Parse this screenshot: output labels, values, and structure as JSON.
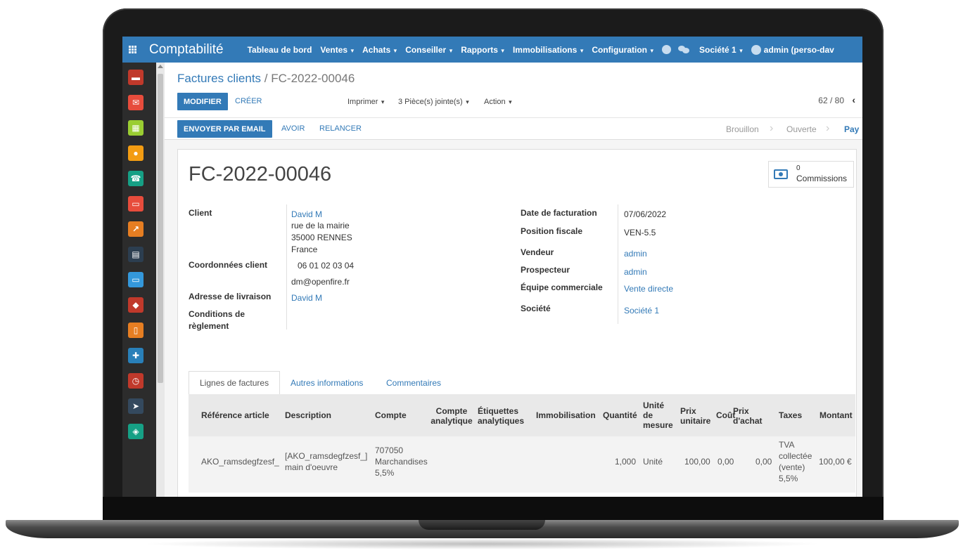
{
  "topnav": {
    "brand": "Comptabilité",
    "menus": [
      "Tableau de bord",
      "Ventes",
      "Achats",
      "Conseiller",
      "Rapports",
      "Immobilisations",
      "Configuration"
    ],
    "company": "Société 1",
    "user": "admin (perso-dav"
  },
  "sidebar": {
    "icons": [
      {
        "name": "discuss-icon",
        "color": "#c0392b"
      },
      {
        "name": "mail-icon",
        "color": "#e74c3c"
      },
      {
        "name": "calendar-icon",
        "color": "#9acd32"
      },
      {
        "name": "map-pin-icon",
        "color": "#f39c12"
      },
      {
        "name": "contacts-icon",
        "color": "#16a085"
      },
      {
        "name": "folder-icon",
        "color": "#e74c3c"
      },
      {
        "name": "chart-icon",
        "color": "#e67e22"
      },
      {
        "name": "calculator-icon",
        "color": "#2c3e50"
      },
      {
        "name": "card-icon",
        "color": "#3498db"
      },
      {
        "name": "box-icon",
        "color": "#c0392b"
      },
      {
        "name": "document-icon",
        "color": "#e67e22"
      },
      {
        "name": "puzzle-icon",
        "color": "#2980b9"
      },
      {
        "name": "clock-icon",
        "color": "#c0392b"
      },
      {
        "name": "send-icon",
        "color": "#34495e"
      },
      {
        "name": "ticket-icon",
        "color": "#16a085"
      }
    ]
  },
  "breadcrumb": {
    "parent": "Factures clients",
    "separator": "/",
    "current": "FC-2022-00046"
  },
  "actions": {
    "edit": "MODIFIER",
    "create": "CRÉER",
    "print": "Imprimer",
    "attachments": "3 Pièce(s) jointe(s)",
    "action": "Action",
    "pager": "62 / 80",
    "prev": "‹",
    "next": "›"
  },
  "statusbar": {
    "send_email": "ENVOYER PAR EMAIL",
    "credit_note": "AVOIR",
    "follow_up": "RELANCER",
    "stages": [
      "Brouillon",
      "Ouverte",
      "Pay"
    ]
  },
  "invoice": {
    "title": "FC-2022-00046",
    "commissions_count": "0",
    "commissions_label": "Commissions",
    "labels": {
      "client": "Client",
      "contact": "Coordonnées client",
      "delivery": "Adresse de livraison",
      "terms": "Conditions de règlement",
      "invoice_date": "Date de facturation",
      "fiscal_position": "Position fiscale",
      "salesperson": "Vendeur",
      "prospector": "Prospecteur",
      "team": "Équipe commerciale",
      "company": "Société"
    },
    "client_name": "David M",
    "address": [
      "rue de la mairie",
      "35000 RENNES",
      "France"
    ],
    "phone": "06 01 02 03 04",
    "email": "dm@openfire.fr",
    "delivery_address": "David M",
    "invoice_date": "07/06/2022",
    "fiscal_position": "VEN-5.5",
    "salesperson": "admin",
    "prospector": "admin",
    "team": "Vente directe",
    "company": "Société 1"
  },
  "tabs": [
    "Lignes de factures",
    "Autres informations",
    "Commentaires"
  ],
  "lines": {
    "headers": {
      "ref": "Référence article",
      "desc": "Description",
      "account": "Compte",
      "analytic_account": [
        "Compte",
        "analytique"
      ],
      "analytic_tags": [
        "Étiquettes",
        "analytiques"
      ],
      "asset": "Immobilisation",
      "qty": "Quantité",
      "uom": [
        "Unité",
        "de",
        "mesure"
      ],
      "unit_price": [
        "Prix",
        "unitaire"
      ],
      "cost": "Coût",
      "purchase_price": [
        "Prix",
        "d'achat"
      ],
      "taxes": "Taxes",
      "amount": "Montant"
    },
    "rows": [
      {
        "ref": "AKO_ramsdegfzesf_",
        "desc": [
          "[AKO_ramsdegfzesf_]",
          "main d'oeuvre"
        ],
        "account": [
          "707050",
          "Marchandises",
          "5,5%"
        ],
        "qty": "1,000",
        "uom": "Unité",
        "unit_price": "100,00",
        "cost": "0,00",
        "purchase_price": "0,00",
        "taxes": [
          "TVA",
          "collectée",
          "(vente)",
          "5,5%"
        ],
        "amount": "100,00 €"
      }
    ]
  }
}
